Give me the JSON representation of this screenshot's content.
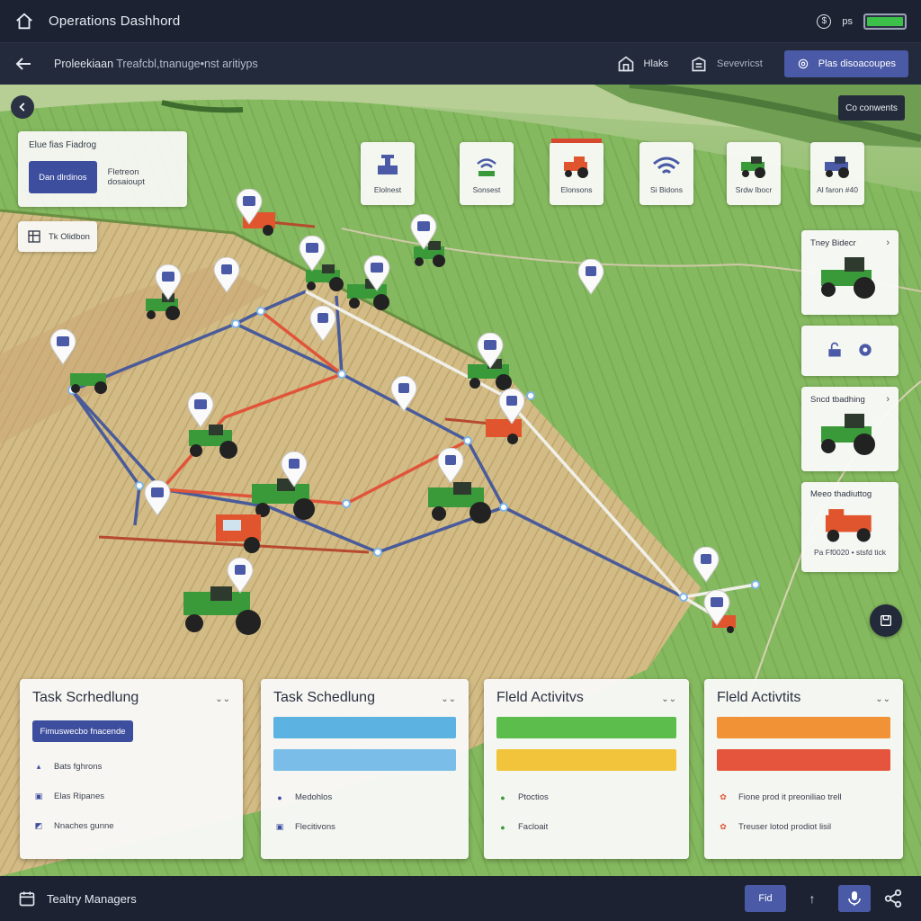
{
  "app": {
    "title": "Operations Dashhord",
    "status_ps": "ps",
    "battery_level": 1.0
  },
  "subbar": {
    "breadcrumb_main": "Proleekiaan",
    "breadcrumb_rest": "Treafcbl,tnanuge•nst aritiyps",
    "nav_home": "Hlaks",
    "nav_server": "Sevevricst",
    "primary_btn": "Plas disoacoupes"
  },
  "map": {
    "filter_label": "Elue fias Fiadrog",
    "filter_button": "Dan dlrdinos",
    "filter_aux": "Fletreon dosaioupt",
    "legend_chip": "Tk Olidbon",
    "comments_btn": "Co conwents"
  },
  "equipment": [
    {
      "label": "Elolnest",
      "icon": "drill-icon"
    },
    {
      "label": "Sonsest",
      "icon": "wifi-sensor-icon"
    },
    {
      "label": "Elonsons",
      "icon": "red-tractor-icon"
    },
    {
      "label": "Si Bidons",
      "icon": "wifi-icon"
    },
    {
      "label": "Srdw Ibocr",
      "icon": "green-tractor-icon"
    },
    {
      "label": "Al faron #40",
      "icon": "blue-tractor-icon"
    }
  ],
  "side": {
    "card1_title": "Tney Bidecr",
    "card3_title": "Sncd tbadhing",
    "card4_title": "Meeo thadiuttog",
    "card4_foot": "Pa Ff0020 • stsfd tick"
  },
  "panels": {
    "p1": {
      "title": "Task Scrhedlung",
      "button": "Fimuswecbo fnacende",
      "items": [
        "Bats fghrons",
        "Elas Ripanes",
        "Nnaches gunne"
      ]
    },
    "p2": {
      "title": "Task Schedlung",
      "items": [
        "Medohlos",
        "Flecitivons"
      ],
      "bar_colors": [
        "#5cb3e2",
        "#79bde8"
      ]
    },
    "p3": {
      "title": "Fleld Activitvs",
      "items": [
        "Ptoctios",
        "Facloait"
      ],
      "bar_colors": [
        "#5cbd4c",
        "#f2c43b"
      ]
    },
    "p4": {
      "title": "Fleld Activtits",
      "items": [
        "Fione prod it preoniliao trell",
        "Treuser lotod prodiot lisil"
      ],
      "bar_colors": [
        "#f29236",
        "#e5553d"
      ]
    }
  },
  "footer": {
    "name": "Tealtry Managers",
    "button": "Fid"
  },
  "colors": {
    "accent": "#4a5aa6",
    "dark_bar": "#1c2232",
    "route_blue": "#4a5b9a",
    "route_red": "#e0553a",
    "route_white": "#f0f0e8",
    "tractor_green": "#3a9a3a",
    "tractor_red": "#e0552e"
  }
}
